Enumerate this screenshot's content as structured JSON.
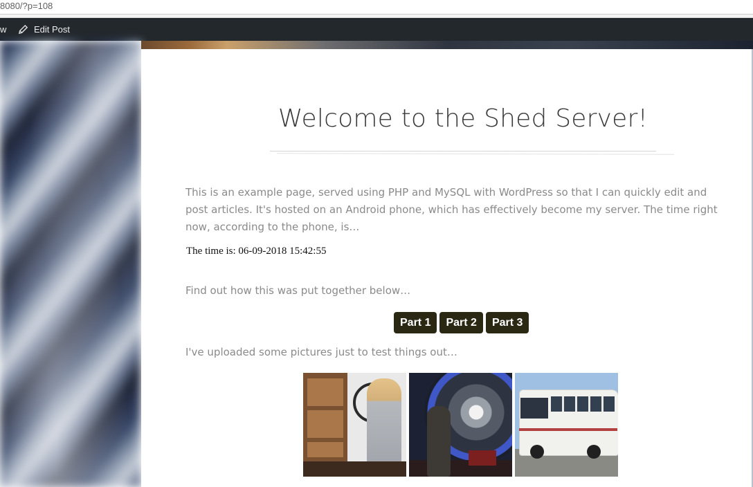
{
  "browser": {
    "url_fragment": "8080/?p=108"
  },
  "admin_bar": {
    "view_label": "w",
    "edit_label": "Edit Post",
    "icons": [
      "pencil-icon"
    ]
  },
  "page": {
    "title": "Welcome to the Shed Server!",
    "intro": "This is an example page, served using PHP and MySQL with WordPress so that I can quickly edit and post articles. It's hosted on an Android phone, which has effectively become my server. The time right now, according to the phone, is…",
    "time_text": "The time is: 06-09-2018 15:42:55",
    "find_out": "Find out how this was put together below…",
    "buttons": [
      {
        "label": "Part 1"
      },
      {
        "label": "Part 2"
      },
      {
        "label": "Part 3"
      }
    ],
    "uploaded": "I've uploaded some pictures just to test things out…",
    "gallery": [
      {
        "name": "gallery-photo-woman-phone"
      },
      {
        "name": "gallery-photo-man-turbine"
      },
      {
        "name": "gallery-photo-white-bus"
      }
    ]
  },
  "colors": {
    "button_bg": "#2a2712",
    "admin_bar_bg": "#23282d",
    "text_muted": "#8a8a8a"
  }
}
